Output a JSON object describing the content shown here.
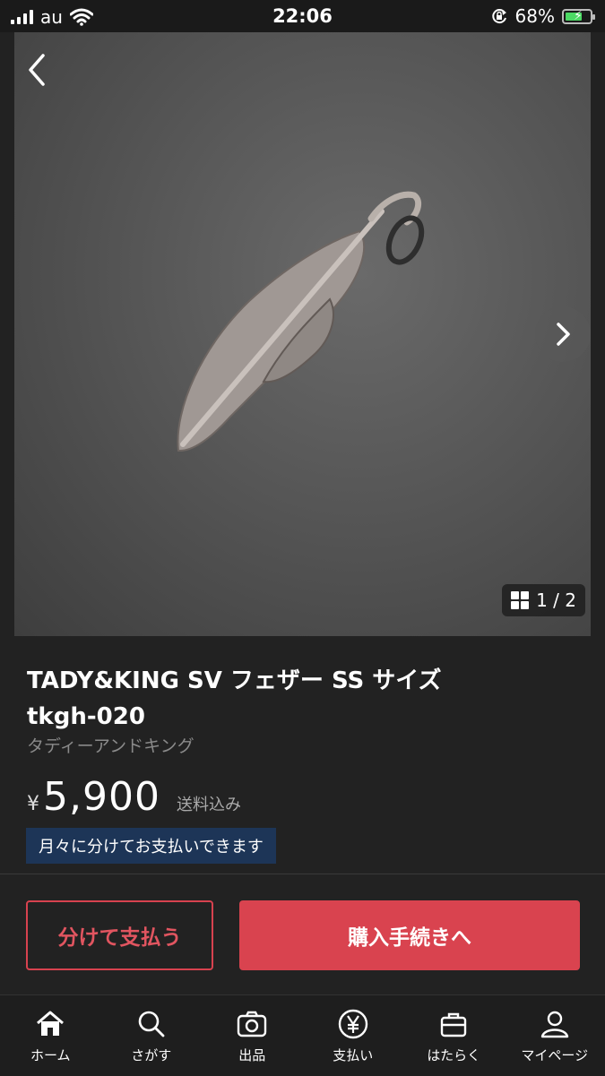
{
  "status": {
    "carrier": "au",
    "time": "22:06",
    "battery": "68%",
    "battery_level": 0.68
  },
  "gallery": {
    "counter": "1 / 2"
  },
  "item": {
    "title_line1": "TADY&KING SV フェザー SS サイズ",
    "title_line2": "tkgh-020",
    "brand": "タディーアンドキング",
    "currency": "¥",
    "price": "5,900",
    "shipping": "送料込み",
    "installment_note": "月々に分けてお支払いできます"
  },
  "actions": {
    "split_pay": "分けて支払う",
    "buy": "購入手続きへ"
  },
  "colors": {
    "accent": "#d9434f",
    "badge_bg": "#1d3557",
    "background": "#222222"
  },
  "tabs": [
    {
      "label": "ホーム",
      "icon": "home-icon"
    },
    {
      "label": "さがす",
      "icon": "search-icon"
    },
    {
      "label": "出品",
      "icon": "camera-icon"
    },
    {
      "label": "支払い",
      "icon": "yen-icon"
    },
    {
      "label": "はたらく",
      "icon": "briefcase-icon"
    },
    {
      "label": "マイページ",
      "icon": "person-icon"
    }
  ]
}
